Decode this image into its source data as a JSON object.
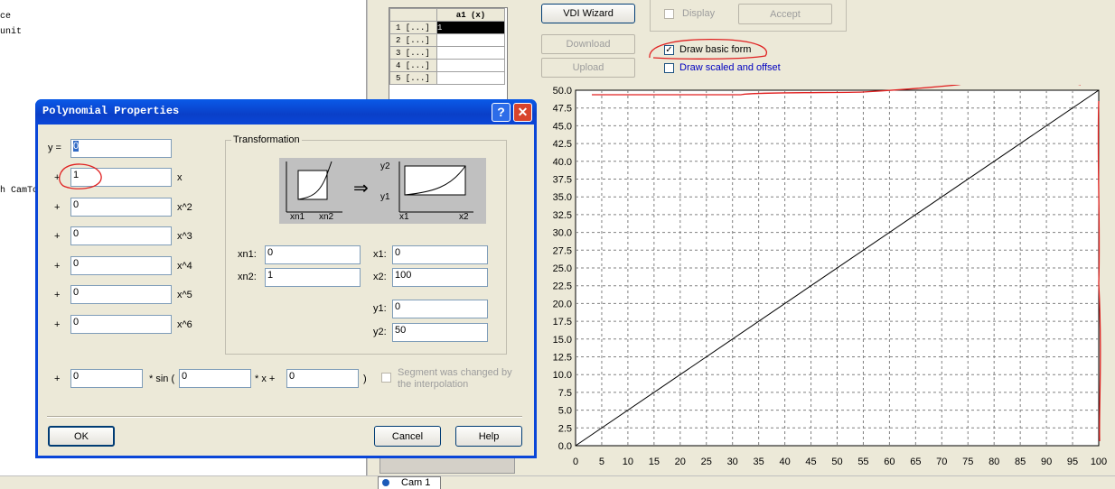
{
  "left_text": [
    "ce",
    "unit",
    "h CamTo"
  ],
  "table": {
    "header": "a1 (x)",
    "rows": [
      {
        "label": "1 [...]",
        "value": "1"
      },
      {
        "label": "2 [...]",
        "value": ""
      },
      {
        "label": "3 [...]",
        "value": ""
      },
      {
        "label": "4 [...]",
        "value": ""
      },
      {
        "label": "5 [...]",
        "value": ""
      }
    ]
  },
  "toolbar": {
    "vdi_wizard": "VDI Wizard",
    "download": "Download",
    "upload": "Upload",
    "display": "Display",
    "accept": "Accept",
    "draw_basic": "Draw basic form",
    "draw_basic_checked": true,
    "draw_scaled": "Draw scaled and offset",
    "draw_scaled_checked": false
  },
  "chart_data": {
    "type": "line",
    "x": [
      0,
      100
    ],
    "y": [
      0,
      50
    ],
    "xlim": [
      0,
      100
    ],
    "ylim": [
      0,
      50
    ],
    "xticks": [
      "0",
      "5",
      "10",
      "15",
      "20",
      "25",
      "30",
      "35",
      "40",
      "45",
      "50",
      "55",
      "60",
      "65",
      "70",
      "75",
      "80",
      "85",
      "90",
      "95",
      "100"
    ],
    "yticks": [
      "0.0",
      "2.5",
      "5.0",
      "7.5",
      "10.0",
      "12.5",
      "15.0",
      "17.5",
      "20.0",
      "22.5",
      "25.0",
      "27.5",
      "30.0",
      "32.5",
      "35.0",
      "37.5",
      "40.0",
      "42.5",
      "45.0",
      "47.5",
      "50.0"
    ],
    "grid": true
  },
  "status": {
    "tab": "Cam 1"
  },
  "dialog": {
    "title": "Polynomial Properties",
    "help_icon": "?",
    "close_icon": "✕",
    "y_label": "y =",
    "coef0": "0",
    "coef_rows": [
      {
        "prefix": "+",
        "value": "1",
        "suffix": "x"
      },
      {
        "prefix": "+",
        "value": "0",
        "suffix": "x^2"
      },
      {
        "prefix": "+",
        "value": "0",
        "suffix": "x^3"
      },
      {
        "prefix": "+",
        "value": "0",
        "suffix": "x^4"
      },
      {
        "prefix": "+",
        "value": "0",
        "suffix": "x^5"
      },
      {
        "prefix": "+",
        "value": "0",
        "suffix": "x^6"
      }
    ],
    "transformation": {
      "title": "Transformation",
      "diagram": {
        "xn1": "xn1",
        "xn2": "xn2",
        "x1": "x1",
        "x2": "x2",
        "y1": "y1",
        "y2": "y2",
        "arrow": "⇒"
      },
      "xn1_label": "xn1:",
      "xn1": "0",
      "xn2_label": "xn2:",
      "xn2": "1",
      "x1_label": "x1:",
      "x1": "0",
      "x2_label": "x2:",
      "x2": "100",
      "y1_label": "y1:",
      "y1": "0",
      "y2_label": "y2:",
      "y2": "50"
    },
    "sin_row": {
      "prefix": "+",
      "amp": "0",
      "sin_label": "* sin (",
      "freq": "0",
      "mid_label": "* x  +",
      "phase": "0",
      "close": ")"
    },
    "segment_changed": "Segment was changed by the interpolation",
    "ok": "OK",
    "cancel": "Cancel",
    "help": "Help"
  }
}
